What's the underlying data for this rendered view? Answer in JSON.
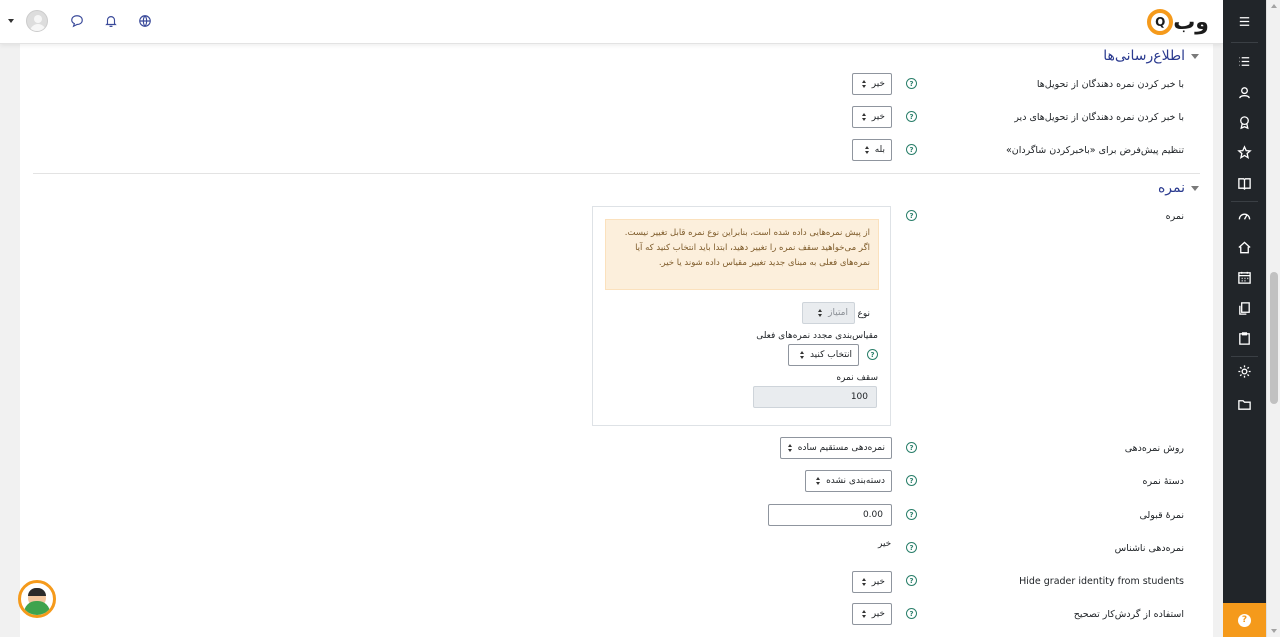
{
  "header": {
    "logo_text": "وب",
    "logo_badge": "Q",
    "icons": [
      "chevron-down-icon",
      "avatar",
      "message-icon",
      "bell-icon",
      "globe-icon"
    ]
  },
  "rail": {
    "icons": [
      "menu-icon",
      "list-icon",
      "participants-icon",
      "badges-icon",
      "star-icon",
      "book-icon",
      "dashboard-icon",
      "home-icon",
      "calendar-icon",
      "files-icon",
      "clipboard-icon",
      "settings-icon",
      "folder-icon",
      "help-icon"
    ]
  },
  "sections": {
    "notifications_title": "اطلاع‌رسانی‌ها",
    "grade_title": "نمره"
  },
  "notifications": {
    "row1": {
      "label": "با خبر کردن نمره دهندگان از تحویل‌ها",
      "value": "خیر"
    },
    "row2": {
      "label": "با خبر کردن نمره دهندگان از تحویل‌های دیر",
      "value": "خیر"
    },
    "row3": {
      "label": "تنظیم پیش‌فرض برای «باخبرکردن شاگردان»",
      "value": "بله"
    }
  },
  "grade": {
    "label": "نمره",
    "warning": "از پیش نمره‌هایی داده شده است، بنابراین نوع نمره قابل تغییر نیست. اگر می‌خواهید سقف نمره را تغییر دهید، ابتدا باید انتخاب کنید که آیا نمره‌های فعلی به مبنای جدید تغییر مقیاس داده شوند یا خیر.",
    "type_label": "نوع",
    "type_value": "امتیاز",
    "rescale_label": "مقیاس‌بندی مجدد نمره‌های فعلی",
    "rescale_value": "انتخاب کنید",
    "max_label": "سقف نمره",
    "max_value": "100"
  },
  "grading": {
    "method_label": "روش نمره‌دهی",
    "method_value": "نمره‌دهی مستقیم ساده",
    "category_label": "دستهٔ نمره",
    "category_value": "دسته‌بندی نشده",
    "pass_label": "نمرهٔ قبولی",
    "pass_value": "0.00",
    "anon_label": "نمره‌دهی ناشناس",
    "anon_value": "خیر",
    "hide_label": "Hide grader identity from students",
    "hide_value": "خیر",
    "workflow_label": "استفاده از گردش‌کار تصحیح",
    "workflow_value": "خیر"
  },
  "help_symbol": "?",
  "colors": {
    "accent": "#f59a1b",
    "rail": "#212529",
    "heading": "#2a3a8f",
    "warning_bg": "#fcefdc"
  }
}
